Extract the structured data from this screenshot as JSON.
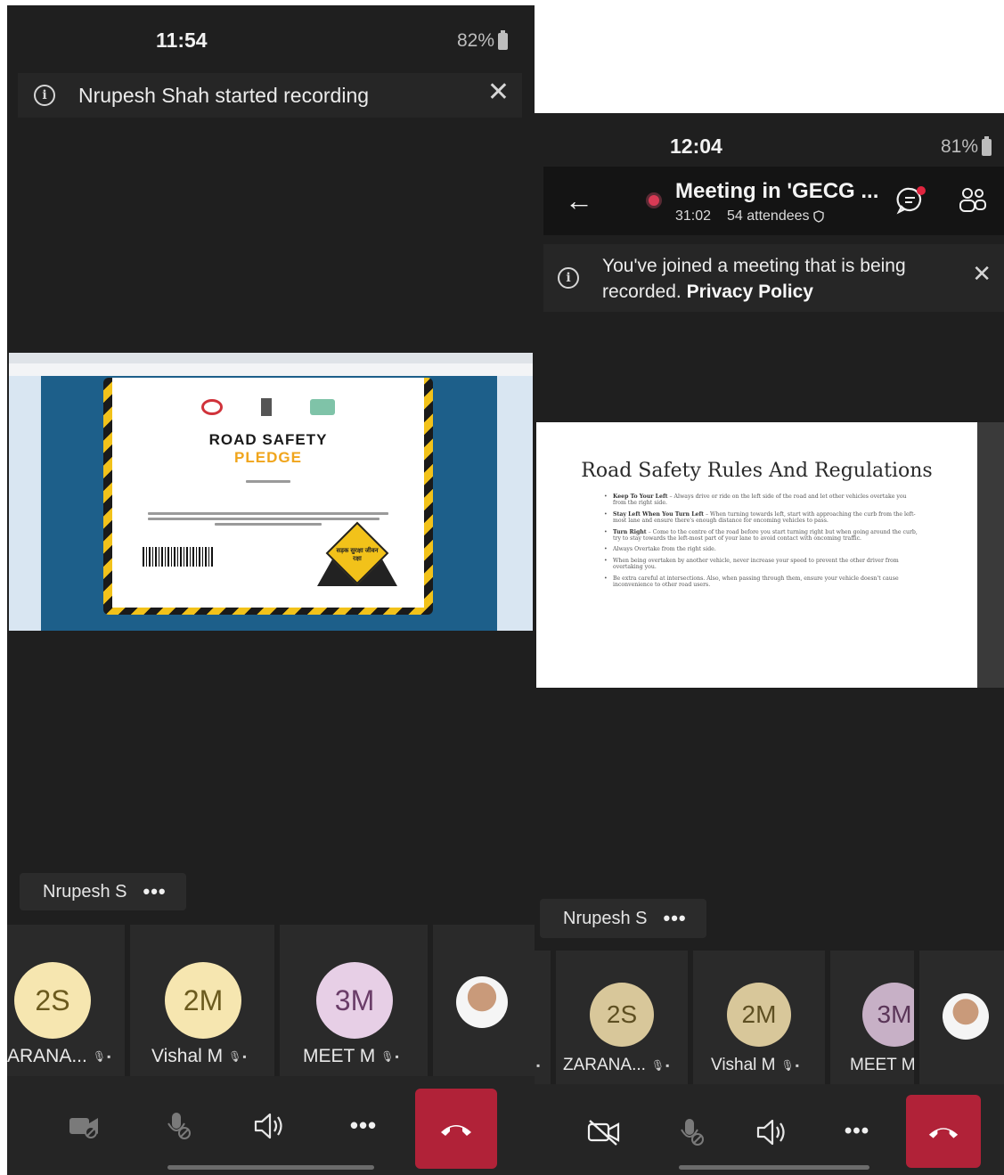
{
  "left": {
    "status": {
      "time": "11:54",
      "battery": "82%"
    },
    "banner": {
      "text": "Nrupesh Shah started recording"
    },
    "share": {
      "title_line1": "ROAD SAFETY",
      "title_line2": "PLEDGE",
      "sign_text": "सड़क सुरक्षा जीवन रक्षा"
    },
    "presenter": {
      "name": "Nrupesh S",
      "more": "•••"
    },
    "participants": [
      {
        "initials": "2S",
        "name": "ARANA...",
        "color": "#f6e6b0",
        "text_color": "#6b5a1e"
      },
      {
        "initials": "2M",
        "name": "Vishal M",
        "color": "#f6e6b0",
        "text_color": "#6b5a1e"
      },
      {
        "initials": "3M",
        "name": "MEET M",
        "color": "#e7cfe6",
        "text_color": "#6a3d68"
      }
    ],
    "controls": {
      "more": "•••"
    }
  },
  "right": {
    "status": {
      "time": "12:04",
      "battery": "81%"
    },
    "header": {
      "title": "Meeting in 'GECG ...",
      "duration": "31:02",
      "attendees": "54 attendees"
    },
    "banner": {
      "text": "You've joined a meeting that is being recorded.",
      "link": "Privacy Policy"
    },
    "slide": {
      "title": "Road Safety Rules And Regulations",
      "bullets": [
        {
          "head": "Keep To Your Left",
          "body": " – Always drive or ride on the left side of the road and let other vehicles overtake you from the right side."
        },
        {
          "head": "Stay Left When You Turn Left",
          "body": " – When turning towards left, start with approaching the curb from the left-most lane and ensure there's enough distance for oncoming vehicles to pass."
        },
        {
          "head": "Turn Right",
          "body": " – Come to the centre of the road before you start turning right but when going around the curb, try to stay towards the left-most part of your lane to avoid contact with oncoming traffic."
        },
        {
          "head": "",
          "body": "Always Overtake from the right side."
        },
        {
          "head": "",
          "body": "When being overtaken by another vehicle, never increase your speed to prevent the other driver from overtaking you."
        },
        {
          "head": "",
          "body": "Be extra careful at intersections. Also, when passing through them, ensure your vehicle doesn't cause inconvenience to other road users."
        }
      ]
    },
    "presenter": {
      "name": "Nrupesh S",
      "more": "•••"
    },
    "participants": [
      {
        "initials": "2S",
        "name": "ZARANA...",
        "color": "#d8c79a",
        "text_color": "#5e4f22"
      },
      {
        "initials": "2M",
        "name": "Vishal M",
        "color": "#d8c79a",
        "text_color": "#5e4f22"
      },
      {
        "initials": "3M",
        "name": "MEET M",
        "color": "#c7b0c6",
        "text_color": "#5a3558"
      }
    ],
    "controls": {
      "more": "•••"
    }
  }
}
